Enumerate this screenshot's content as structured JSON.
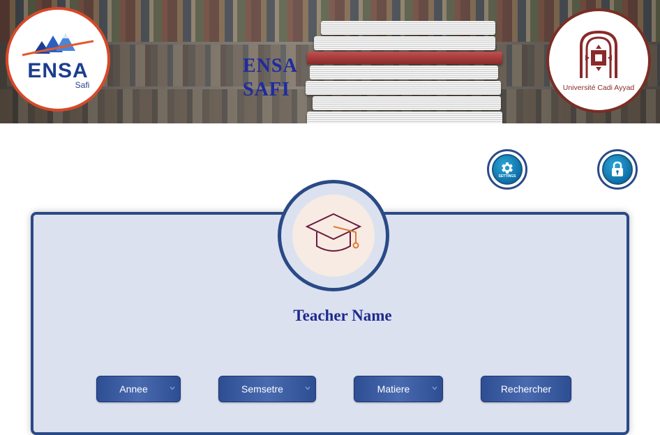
{
  "header": {
    "title_line1": "ENSA",
    "title_line2": "SAFI",
    "left_logo": {
      "word": "ENSA",
      "subword": "Safi"
    },
    "right_logo": {
      "caption": "Université Cadi Ayyad"
    }
  },
  "actions": {
    "settings_caption": "SETTINGS",
    "settings_icon": "gear-icon",
    "lock_icon": "lock-icon"
  },
  "profile": {
    "icon": "graduation-cap-icon",
    "name": "Teacher Name"
  },
  "filters": {
    "annee": "Annee",
    "semestre": "Semsetre",
    "matiere": "Matiere",
    "search_label": "Rechercher"
  },
  "colors": {
    "primary_blue": "#2a4a86",
    "title_blue": "#1e2ba0",
    "card_bg": "#dbe1ef",
    "ensa_orange": "#d6492a",
    "ucad_maroon": "#7a2e24"
  }
}
